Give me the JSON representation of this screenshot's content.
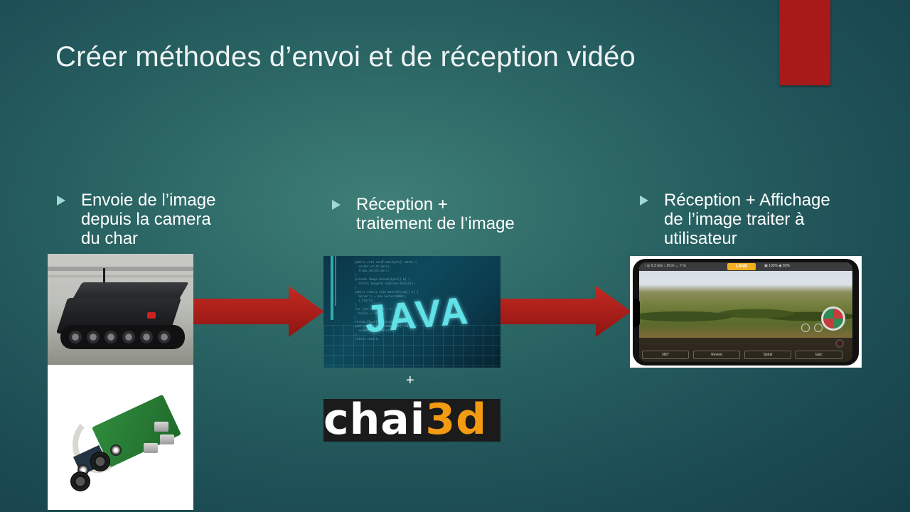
{
  "slide": {
    "title": "Créer méthodes d’envoi et de réception vidéo",
    "accent_color": "#a8191a",
    "bullet_color": "#9fd8d4"
  },
  "bullets": [
    {
      "text": "Envoie de l’image\ndepuis la camera\ndu char"
    },
    {
      "text": "Réception +\ntraitement de l’image"
    },
    {
      "text": "Réception + Affichage\nde l’image traiter à\nutilisateur"
    }
  ],
  "images": {
    "java_word": "JAVA",
    "chai_prefix": "chai",
    "chai_suffix": "3d",
    "plus": "+",
    "phone_land": "LAND"
  },
  "arrows": {
    "color": "#b01e1a",
    "icon": "right-arrow-icon"
  }
}
